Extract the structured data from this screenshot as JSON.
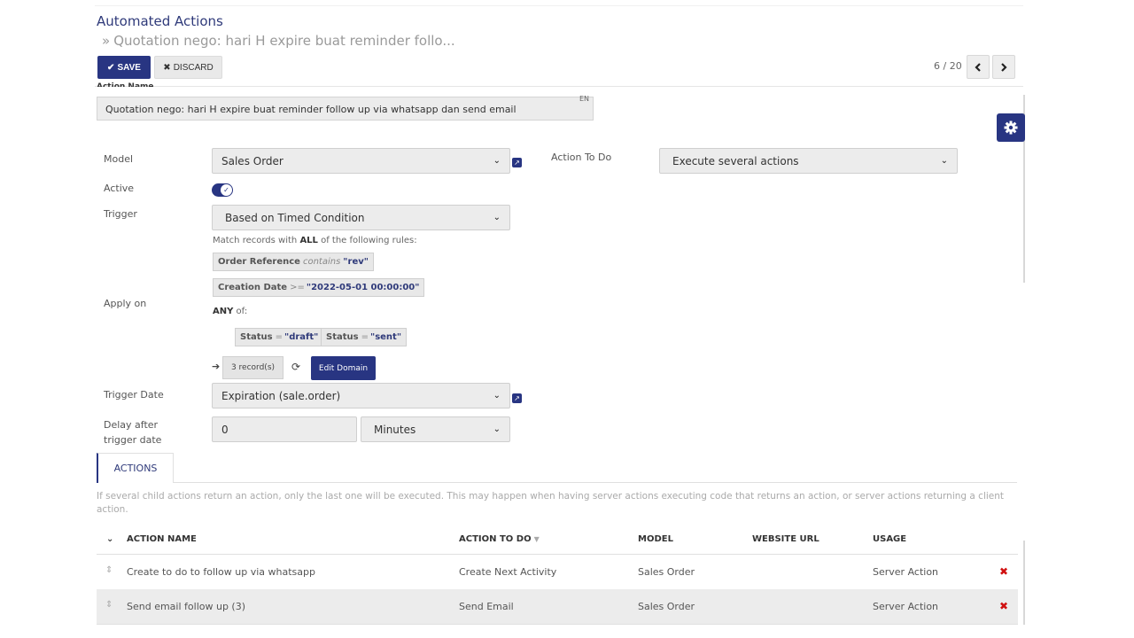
{
  "breadcrumb": {
    "parent": "Automated Actions",
    "current": "Quotation nego: hari H expire buat reminder follo..."
  },
  "toolbar": {
    "save_label": "SAVE",
    "discard_label": "DISCARD"
  },
  "pager": {
    "text": "6 / 20"
  },
  "form": {
    "action_name_label": "Action Name",
    "action_name_value": "Quotation nego: hari H expire buat reminder follow up via whatsapp dan send email",
    "lang": "EN",
    "model_label": "Model",
    "model_value": "Sales Order",
    "action_to_do_label": "Action To Do",
    "action_to_do_value": "Execute several actions",
    "active_label": "Active",
    "active": true,
    "trigger_label": "Trigger",
    "trigger_value": "Based on Timed Condition",
    "apply_on_label": "Apply on",
    "domain": {
      "match_prefix": "Match records with",
      "match_all": "ALL",
      "match_suffix": "of the following rules:",
      "rule1_field": "Order Reference",
      "rule1_op": "contains",
      "rule1_value": "\"rev\"",
      "rule2_field": "Creation Date",
      "rule2_op": ">=",
      "rule2_value": "\"2022-05-01 00:00:00\"",
      "any_label": "ANY",
      "any_suffix": "of:",
      "rule3_field": "Status",
      "rule3_op": "=",
      "rule3_value": "\"draft\"",
      "rule4_field": "Status",
      "rule4_op": "=",
      "rule4_value": "\"sent\"",
      "records_label": "3 record(s)",
      "edit_domain_label": "Edit Domain"
    },
    "trigger_date_label": "Trigger Date",
    "trigger_date_value": "Expiration (sale.order)",
    "delay_label_1": "Delay after",
    "delay_label_2": "trigger date",
    "delay_value": "0",
    "delay_unit": "Minutes"
  },
  "tabs": [
    {
      "label": "ACTIONS",
      "active": true
    }
  ],
  "actions_note": "If several child actions return an action, only the last one will be executed. This may happen when having server actions executing code that returns an action, or server actions returning a client action.",
  "table": {
    "columns": [
      "ACTION NAME",
      "ACTION TO DO",
      "MODEL",
      "WEBSITE URL",
      "USAGE"
    ],
    "rows": [
      {
        "name": "Create to do to follow up via whatsapp",
        "action": "Create Next Activity",
        "model": "Sales Order",
        "url": "",
        "usage": "Server Action"
      },
      {
        "name": "Send email follow up (3)",
        "action": "Send Email",
        "model": "Sales Order",
        "url": "",
        "usage": "Server Action"
      }
    ]
  },
  "colors": {
    "primary": "#283582",
    "delete": "#d01010"
  }
}
